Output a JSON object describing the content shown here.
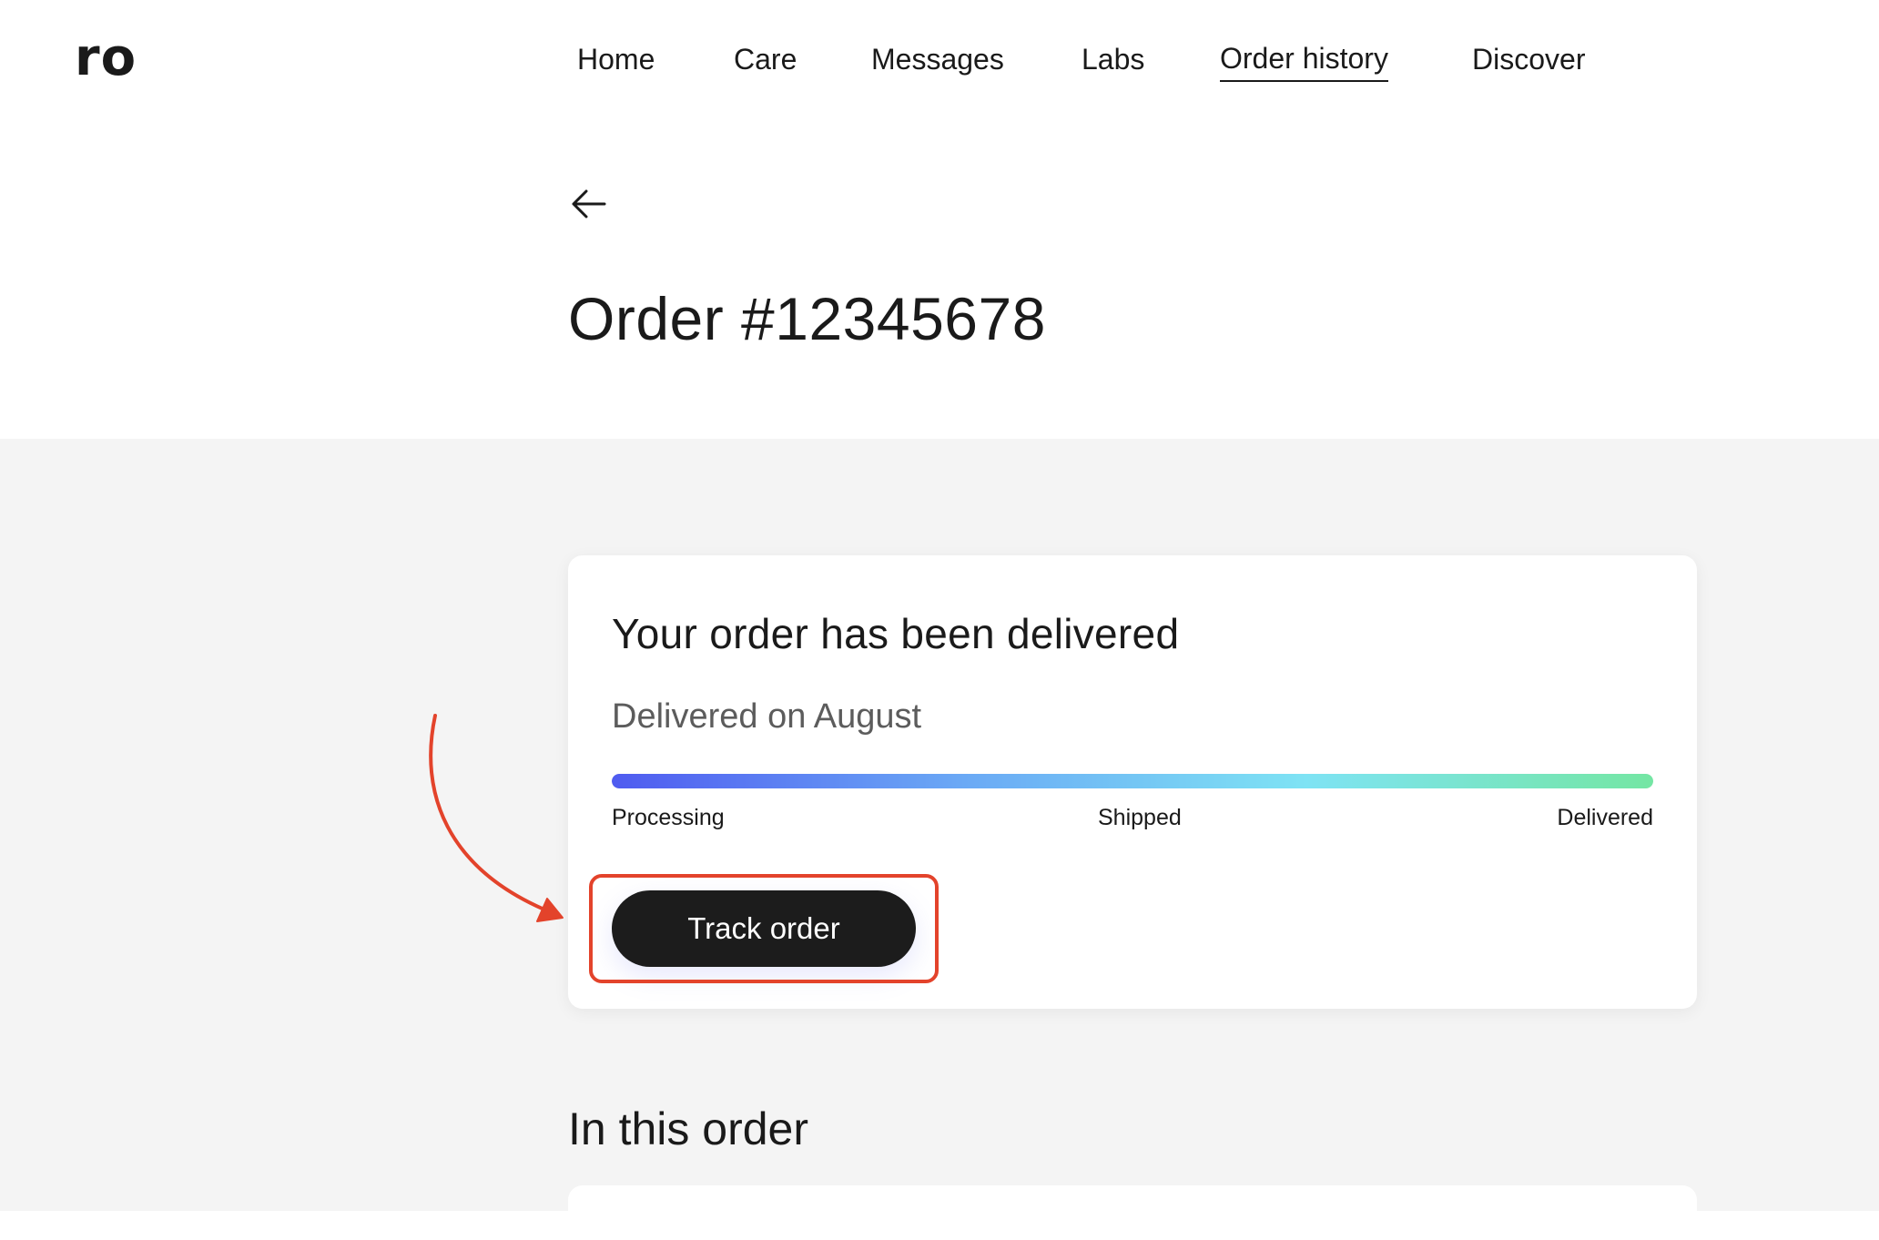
{
  "app": {
    "logo": "ro"
  },
  "nav": {
    "items": [
      {
        "label": "Home"
      },
      {
        "label": "Care"
      },
      {
        "label": "Messages"
      },
      {
        "label": "Labs"
      },
      {
        "label": "Order history",
        "active": true
      },
      {
        "label": "Discover"
      }
    ]
  },
  "page": {
    "back_icon": "arrow-left-icon",
    "title": "Order #12345678"
  },
  "status_card": {
    "title": "Your order has been delivered",
    "subtitle": "Delivered on August",
    "progress": 1.0,
    "progress_colors": [
      "#4f5bf0",
      "#6aa8f5",
      "#7ee3f4",
      "#74e6a3"
    ],
    "steps": [
      "Processing",
      "Shipped",
      "Delivered"
    ],
    "track_button_label": "Track order"
  },
  "annotation": {
    "color": "#e3432b"
  },
  "order_items": {
    "title": "In this order"
  }
}
